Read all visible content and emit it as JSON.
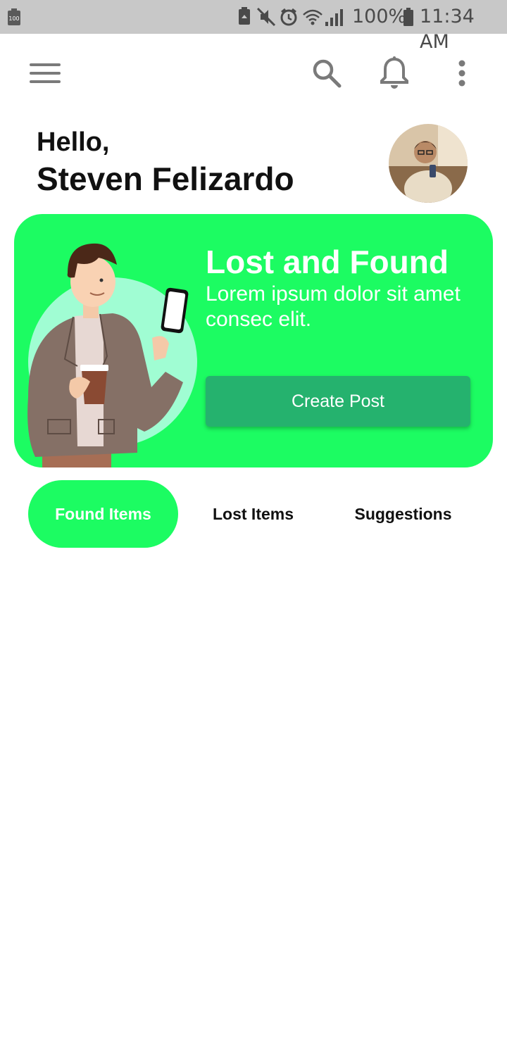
{
  "status_bar": {
    "left_badge": "100",
    "battery_percent": "100%",
    "time": "11:34 AM",
    "icons": [
      "battery-saver-icon",
      "mute-icon",
      "alarm-icon",
      "wifi-icon",
      "signal-icon",
      "battery-icon"
    ]
  },
  "app_bar": {
    "icons": [
      "menu-icon",
      "search-icon",
      "bell-icon",
      "more-vert-icon"
    ]
  },
  "header": {
    "greeting": "Hello,",
    "user_name": "Steven Felizardo"
  },
  "banner": {
    "title": "Lost and Found",
    "text": "Lorem ipsum dolor sit amet consec elit.",
    "button_label": "Create Post"
  },
  "tabs": [
    {
      "label": "Found Items",
      "active": true
    },
    {
      "label": "Lost Items",
      "active": false
    },
    {
      "label": "Suggestions",
      "active": false
    }
  ],
  "colors": {
    "accent": "#1cfc62",
    "button": "#25b26e",
    "status_bar": "#c8c8c8",
    "icon_gray": "#7a7a7a"
  }
}
